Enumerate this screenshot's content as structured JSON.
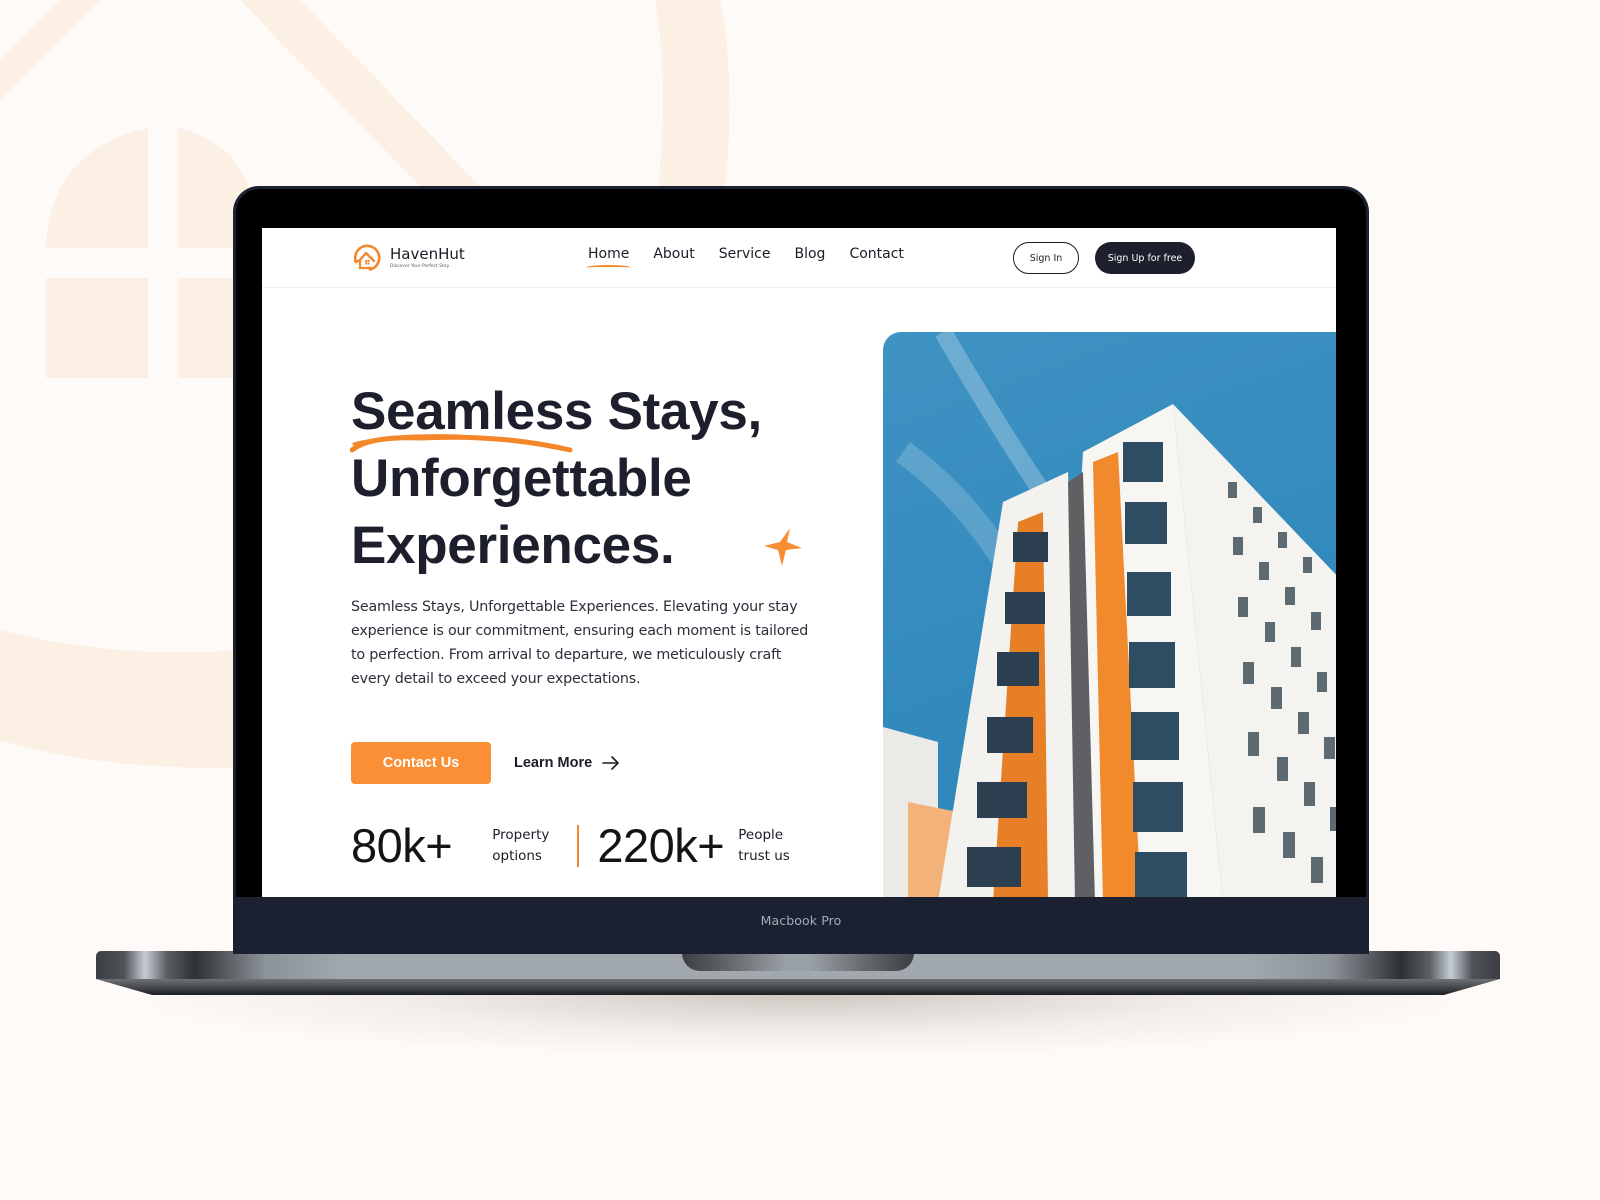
{
  "device": {
    "label": "Macbook Pro"
  },
  "brand": {
    "name": "HavenHut",
    "tagline": "Discover Your Perfect Stay",
    "logo_icon": "house-circle-icon",
    "accent_color": "#f5872b",
    "dark_color": "#1d202c"
  },
  "nav": {
    "links": [
      {
        "label": "Home",
        "active": true
      },
      {
        "label": "About",
        "active": false
      },
      {
        "label": "Service",
        "active": false
      },
      {
        "label": "Blog",
        "active": false
      },
      {
        "label": "Contact",
        "active": false
      }
    ],
    "sign_in": "Sign In",
    "sign_up": "Sign Up for free"
  },
  "hero": {
    "title_lines": [
      "Seamless Stays,",
      "Unforgettable",
      "Experiences."
    ],
    "description": "Seamless Stays, Unforgettable Experiences. Elevating your stay experience is our commitment, ensuring each moment is tailored to perfection. From arrival to departure, we meticulously craft every detail to exceed your expectations.",
    "primary_cta": "Contact Us",
    "secondary_cta": "Learn More",
    "secondary_icon": "arrow-right-icon",
    "decor_icon": "sparkle-star-icon",
    "image_alt": "Modern white apartment building with orange balconies against a blue sky"
  },
  "stats": [
    {
      "value": "80k+",
      "label_line1": "Property",
      "label_line2": "options"
    },
    {
      "value": "220k+",
      "label_line1": "People",
      "label_line2": "trust us"
    }
  ]
}
